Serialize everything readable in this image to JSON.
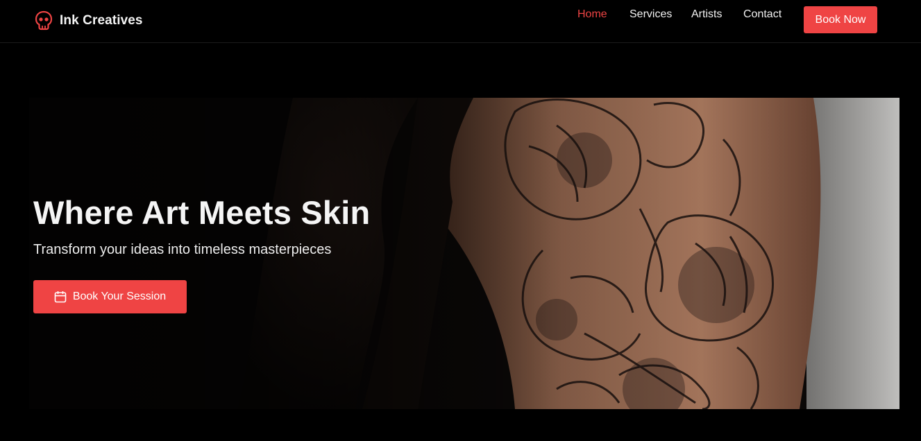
{
  "brand": {
    "name": "Ink Creatives",
    "icon": "skull-icon",
    "accent_color": "#ef4444"
  },
  "nav": {
    "links": [
      {
        "label": "Home",
        "active": true
      },
      {
        "label": "Services",
        "active": false
      },
      {
        "label": "Artists",
        "active": false
      },
      {
        "label": "Contact",
        "active": false
      }
    ],
    "cta_label": "Book Now"
  },
  "hero": {
    "title": "Where Art Meets Skin",
    "subtitle": "Transform your ideas into timeless masterpieces",
    "cta_label": "Book Your Session",
    "cta_icon": "calendar-icon",
    "image": "tattooed-arm-photo"
  },
  "colors": {
    "background": "#000000",
    "accent": "#ef4444",
    "text": "#f5f5f5"
  }
}
